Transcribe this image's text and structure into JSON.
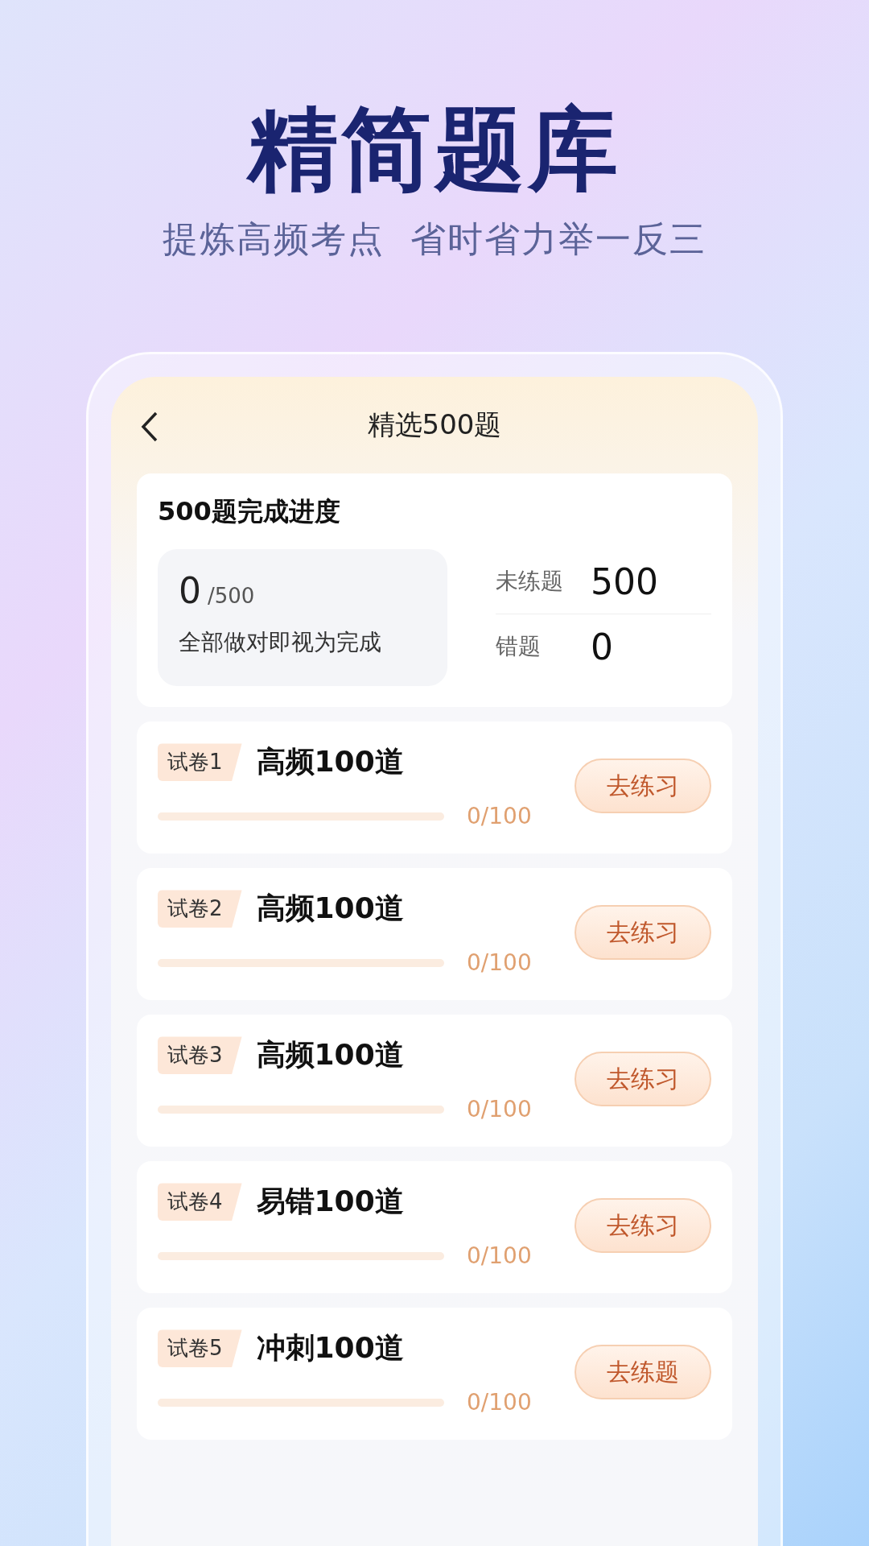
{
  "headline": "精简题库",
  "subheadline": "提炼高频考点  省时省力举一反三",
  "screen": {
    "title": "精选500题",
    "summary": {
      "title": "500题完成进度",
      "done": "0",
      "total": "/500",
      "note": "全部做对即视为完成",
      "stats": [
        {
          "label": "未练题",
          "value": "500"
        },
        {
          "label": "错题",
          "value": "0"
        }
      ]
    },
    "papers": [
      {
        "tag": "试卷1",
        "name": "高频100道",
        "level": 0,
        "progress": "0/100",
        "button": "去练习"
      },
      {
        "tag": "试卷2",
        "name": "高频100道",
        "level": 0,
        "progress": "0/100",
        "button": "去练习"
      },
      {
        "tag": "试卷3",
        "name": "高频100道",
        "level": 0,
        "progress": "0/100",
        "button": "去练习"
      },
      {
        "tag": "试卷4",
        "name": "易错100道",
        "level": 0,
        "progress": "0/100",
        "button": "去练习"
      },
      {
        "tag": "试卷5",
        "name": "冲刺100道",
        "level": 0,
        "progress": "0/100",
        "button": "去练题"
      }
    ]
  }
}
